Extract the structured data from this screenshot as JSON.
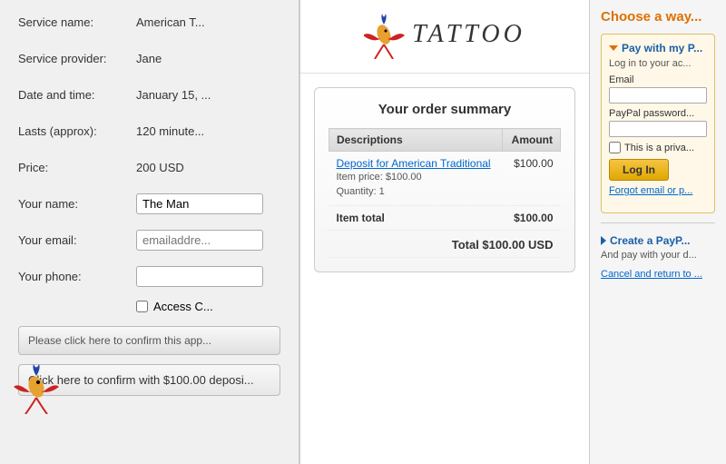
{
  "left": {
    "rows": [
      {
        "label": "Service name:",
        "value": "American T...",
        "type": "text"
      },
      {
        "label": "Service provider:",
        "value": "Jane",
        "type": "text"
      },
      {
        "label": "Date and time:",
        "value": "January 15, ...",
        "type": "text"
      },
      {
        "label": "Lasts (approx):",
        "value": "120 minute...",
        "type": "text"
      },
      {
        "label": "Price:",
        "value": "200 USD",
        "type": "text"
      }
    ],
    "your_name_label": "Your name:",
    "your_name_value": "The Man",
    "your_email_label": "Your email:",
    "your_email_placeholder": "emailaddre...",
    "your_phone_label": "Your phone:",
    "your_phone_value": "",
    "checkbox_label": "Access C...",
    "confirm_text_label": "Please click here to confirm this app...",
    "confirm_deposit_label": "Click here to confirm with $100.00 deposi..."
  },
  "middle": {
    "tattoo_logo_text": "TATTOO",
    "order_summary_title": "Your order summary",
    "table_headers": [
      "Descriptions",
      "Amount"
    ],
    "deposit_link_text": "Deposit for American Traditional",
    "item_price_text": "Item price: $100.00",
    "quantity_text": "Quantity: 1",
    "deposit_amount": "$100.00",
    "item_total_label": "Item total",
    "item_total_amount": "$100.00",
    "total_label": "Total $100.00 USD"
  },
  "right": {
    "choose_way_title": "Choose a way...",
    "pay_with_paypal_label": "Pay with my P...",
    "pay_description": "Log in to your ac...",
    "email_label": "Email",
    "paypal_password_label": "PayPal password...",
    "private_checkbox_label": "This is a priva...",
    "login_label": "Log In",
    "forgot_label": "Forgot email or p...",
    "create_paypal_label": "Create a PayP...",
    "create_description": "And pay with your d...",
    "cancel_label": "Cancel and return to ..."
  },
  "icons": {
    "triangle_down": "▼",
    "triangle_right": "►"
  }
}
